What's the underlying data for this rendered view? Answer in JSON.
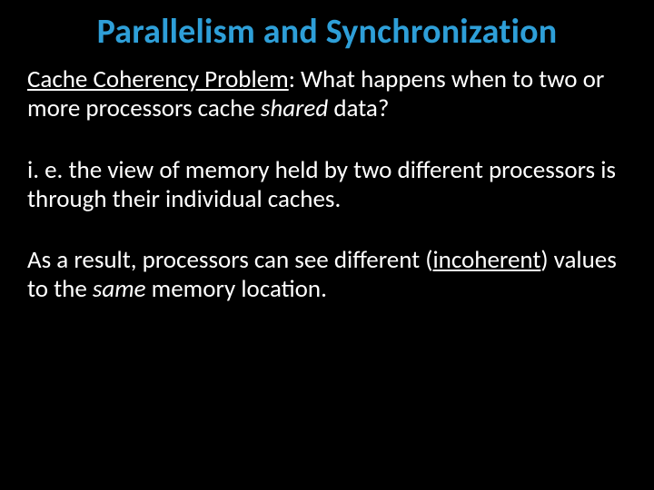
{
  "title": "Parallelism and Synchronization",
  "p1": {
    "lead": "Cache Coherency Problem",
    "mid": ": What happens when to two or more processors cache ",
    "shared": "shared",
    "tail": " data?"
  },
  "p2": "i. e. the view of memory held by two different processors is through their individual caches.",
  "p3": {
    "a": "As a result, processors can see different (",
    "incoherent": "incoherent",
    "b": ") values to the ",
    "same": "same",
    "c": " memory location."
  }
}
